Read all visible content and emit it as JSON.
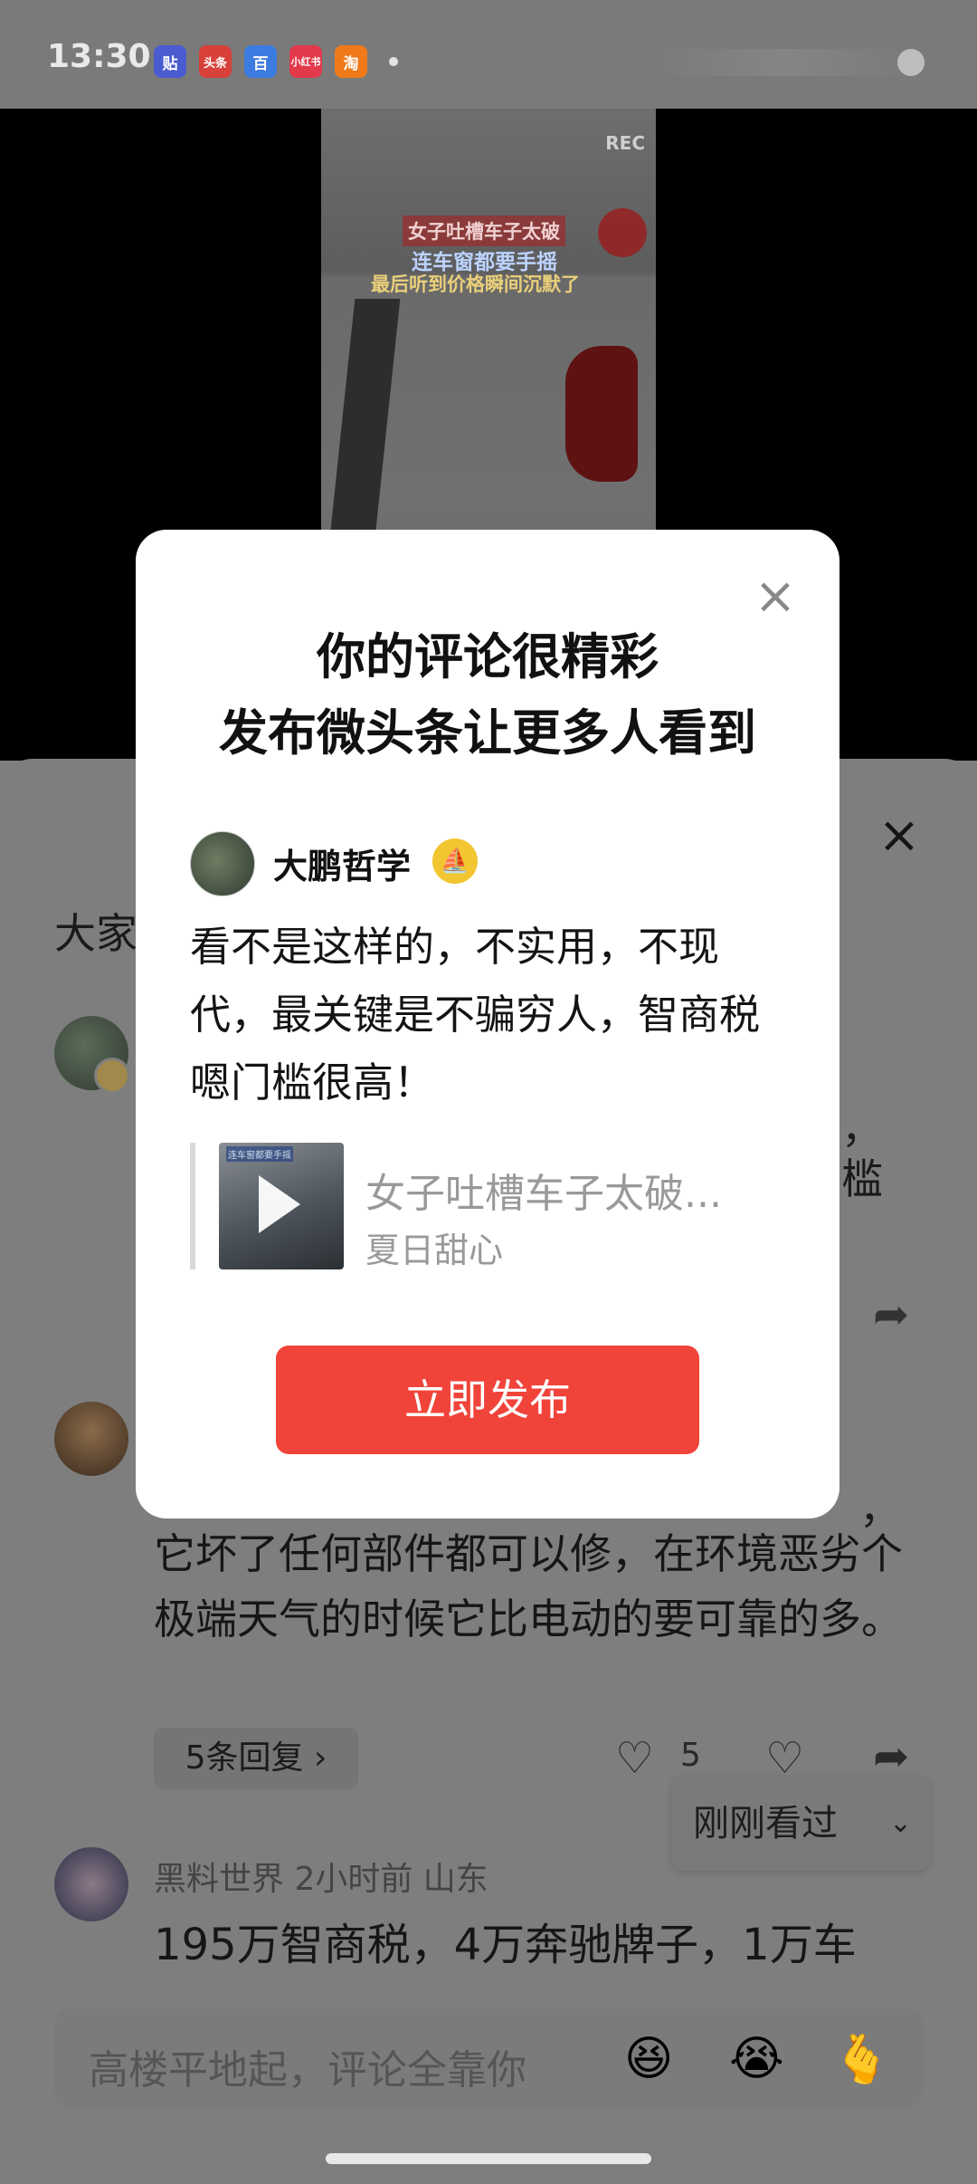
{
  "status": {
    "time": "13:30",
    "apps": [
      "贴",
      "头条",
      "百",
      "小红书",
      "淘"
    ]
  },
  "video": {
    "rec": "REC",
    "caption1": "女子吐槽车子太破",
    "caption2": "连车窗都要手摇",
    "caption3": "最后听到价格瞬间沉默了"
  },
  "sheet": {
    "title": "大家",
    "comment1": {
      "frag1": "，",
      "frag2": "槛"
    },
    "comment2": {
      "frag": "，",
      "body": "它坏了任何部件都可以修，在环境恶劣个极端天气的时候它比电动的要可靠的多。",
      "replies": "5条回复 ›",
      "likes": "5"
    },
    "recent": "刚刚看过",
    "comment3": {
      "meta": "黑料世界  2小时前  山东",
      "body": "195万智商税，4万奔驰牌子，1万车"
    },
    "input_placeholder": "高楼平地起，评论全靠你",
    "emojis": [
      "😆",
      "😭",
      "🫰"
    ]
  },
  "modal": {
    "title_line1": "你的评论很精彩",
    "title_line2": "发布微头条让更多人看到",
    "user_name": "大鹏哲学",
    "comment": "看不是这样的，不实用，不现代，最关键是不骗穷人，智商税嗯门槛很高！",
    "thumb_caption": "连车窗都要手摇",
    "ref_title": "女子吐槽车子太破...",
    "ref_author": "夏日甜心",
    "publish_label": "立即发布"
  }
}
